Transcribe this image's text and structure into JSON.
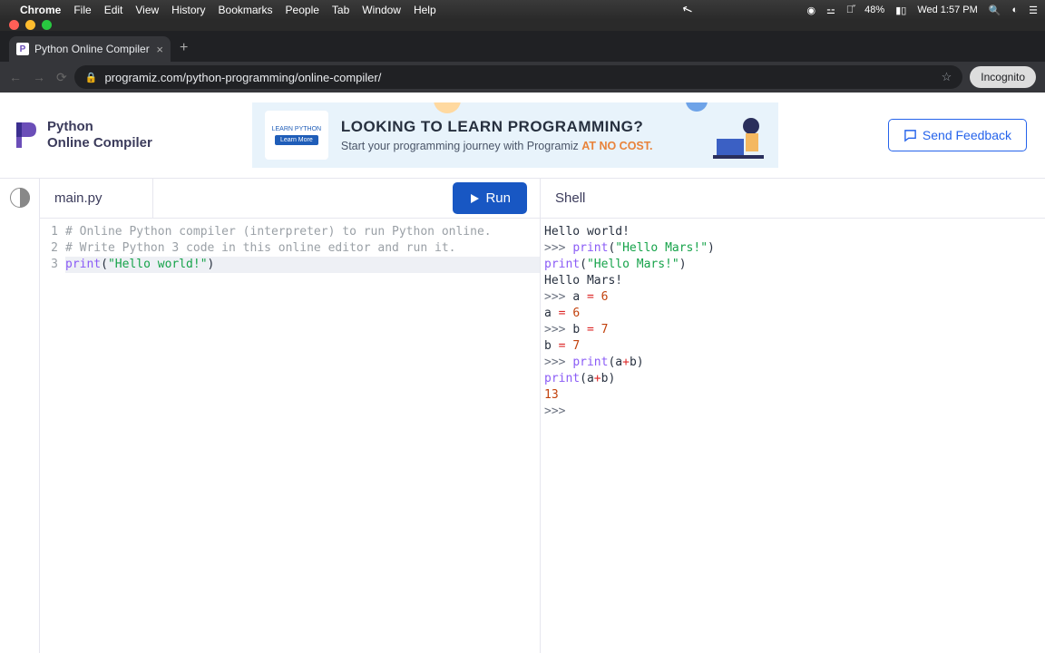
{
  "mac_menu": {
    "app": "Chrome",
    "items": [
      "File",
      "Edit",
      "View",
      "History",
      "Bookmarks",
      "People",
      "Tab",
      "Window",
      "Help"
    ],
    "battery": "48%",
    "datetime": "Wed 1:57 PM"
  },
  "browser": {
    "tab_title": "Python Online Compiler (Interp",
    "url": "programiz.com/python-programming/online-compiler/",
    "incognito_label": "Incognito"
  },
  "header": {
    "logo_line1": "Python",
    "logo_line2": "Online Compiler",
    "banner_title": "LOOKING TO LEARN PROGRAMMING?",
    "banner_sub_pre": "Start your programming journey with Programiz ",
    "banner_sub_accent": "AT NO COST.",
    "banner_learn_label": "Learn More",
    "banner_brand": "LEARN PYTHON",
    "feedback_label": "Send Feedback"
  },
  "editor": {
    "filename": "main.py",
    "run_label": "Run",
    "line_numbers": [
      "1",
      "2",
      "3"
    ],
    "line1_comment": "# Online Python compiler (interpreter) to run Python online.",
    "line2_comment": "# Write Python 3 code in this online editor and run it.",
    "line3_fn": "print",
    "line3_open": "(",
    "line3_str": "\"Hello world!\"",
    "line3_close": ")"
  },
  "shell": {
    "title": "Shell",
    "lines": {
      "l1": "Hello world!",
      "l2_prompt": ">>> ",
      "l2_fn": "print",
      "l2_open": "(",
      "l2_str": "\"Hello Mars!\"",
      "l2_close": ")",
      "l3_fn": "print",
      "l3_open": "(",
      "l3_str": "\"Hello Mars!\"",
      "l3_close": ")",
      "l4": "Hello Mars!",
      "l5_prompt": ">>> ",
      "l5_var": "a ",
      "l5_op": "= ",
      "l5_num": "6",
      "l6_var": "a ",
      "l6_op": "= ",
      "l6_num": "6",
      "l7_prompt": ">>> ",
      "l7_var": "b ",
      "l7_op": "= ",
      "l7_num": "7",
      "l8_var": "b ",
      "l8_op": "= ",
      "l8_num": "7",
      "l9_prompt": ">>> ",
      "l9_fn": "print",
      "l9_open": "(",
      "l9_a": "a",
      "l9_plus": "+",
      "l9_b": "b",
      "l9_close": ")",
      "l10_fn": "print",
      "l10_open": "(",
      "l10_a": "a",
      "l10_plus": "+",
      "l10_b": "b",
      "l10_close": ")",
      "l11": "13",
      "l12_prompt": ">>> "
    }
  }
}
